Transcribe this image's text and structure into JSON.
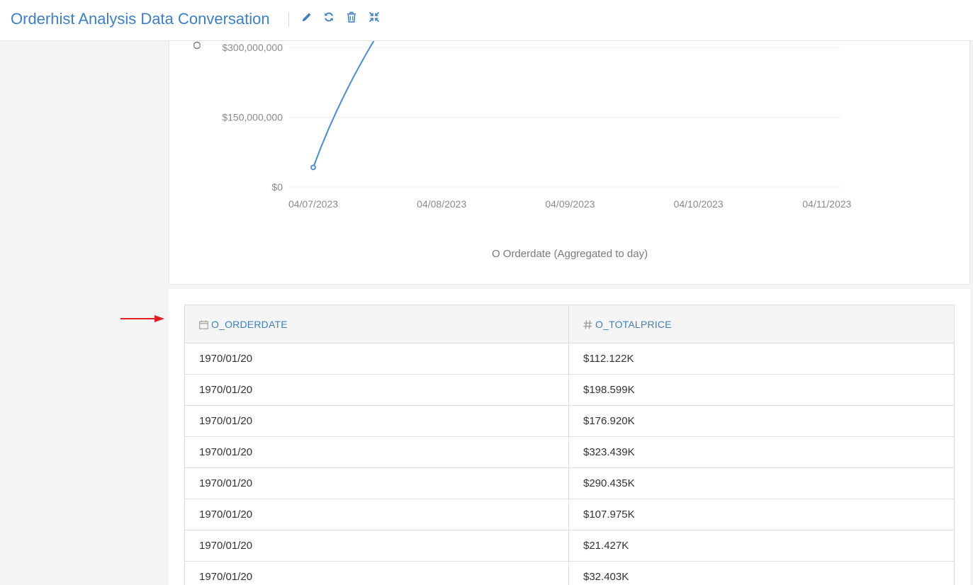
{
  "header": {
    "title": "Orderhist Analysis Data Conversation",
    "actions": [
      {
        "name": "edit",
        "icon": "pencil-icon"
      },
      {
        "name": "refresh",
        "icon": "refresh-icon"
      },
      {
        "name": "delete",
        "icon": "trash-icon"
      },
      {
        "name": "collapse",
        "icon": "compress-icon"
      }
    ],
    "accent_color": "#3d7fc1"
  },
  "chart_data": {
    "type": "line",
    "x": [
      "04/07/2023"
    ],
    "x_ticks": [
      "04/07/2023",
      "04/08/2023",
      "04/09/2023",
      "04/10/2023",
      "04/11/2023"
    ],
    "y_ticks": [
      "$0",
      "$150,000,000",
      "$300,000,000"
    ],
    "y_tick_values": [
      0,
      150000000,
      300000000
    ],
    "xlabel": "O Orderdate (Aggregated to day)",
    "ylabel_fragment": "O",
    "series": [
      {
        "values": [
          42000000
        ],
        "color": "#4a8ccc"
      }
    ],
    "line_continues_above_view": true,
    "grid": true
  },
  "table": {
    "columns": [
      {
        "label": "O_ORDERDATE",
        "icon": "calendar-icon"
      },
      {
        "label": "O_TOTALPRICE",
        "icon": "hash-icon"
      }
    ],
    "rows": [
      [
        "1970/01/20",
        "$112.122K"
      ],
      [
        "1970/01/20",
        "$198.599K"
      ],
      [
        "1970/01/20",
        "$176.920K"
      ],
      [
        "1970/01/20",
        "$323.439K"
      ],
      [
        "1970/01/20",
        "$290.435K"
      ],
      [
        "1970/01/20",
        "$107.975K"
      ],
      [
        "1970/01/20",
        "$21.427K"
      ],
      [
        "1970/01/20",
        "$32.403K"
      ]
    ]
  },
  "annotation": {
    "arrow_color": "#e02020",
    "arrow_icon": "arrow-right-icon"
  }
}
